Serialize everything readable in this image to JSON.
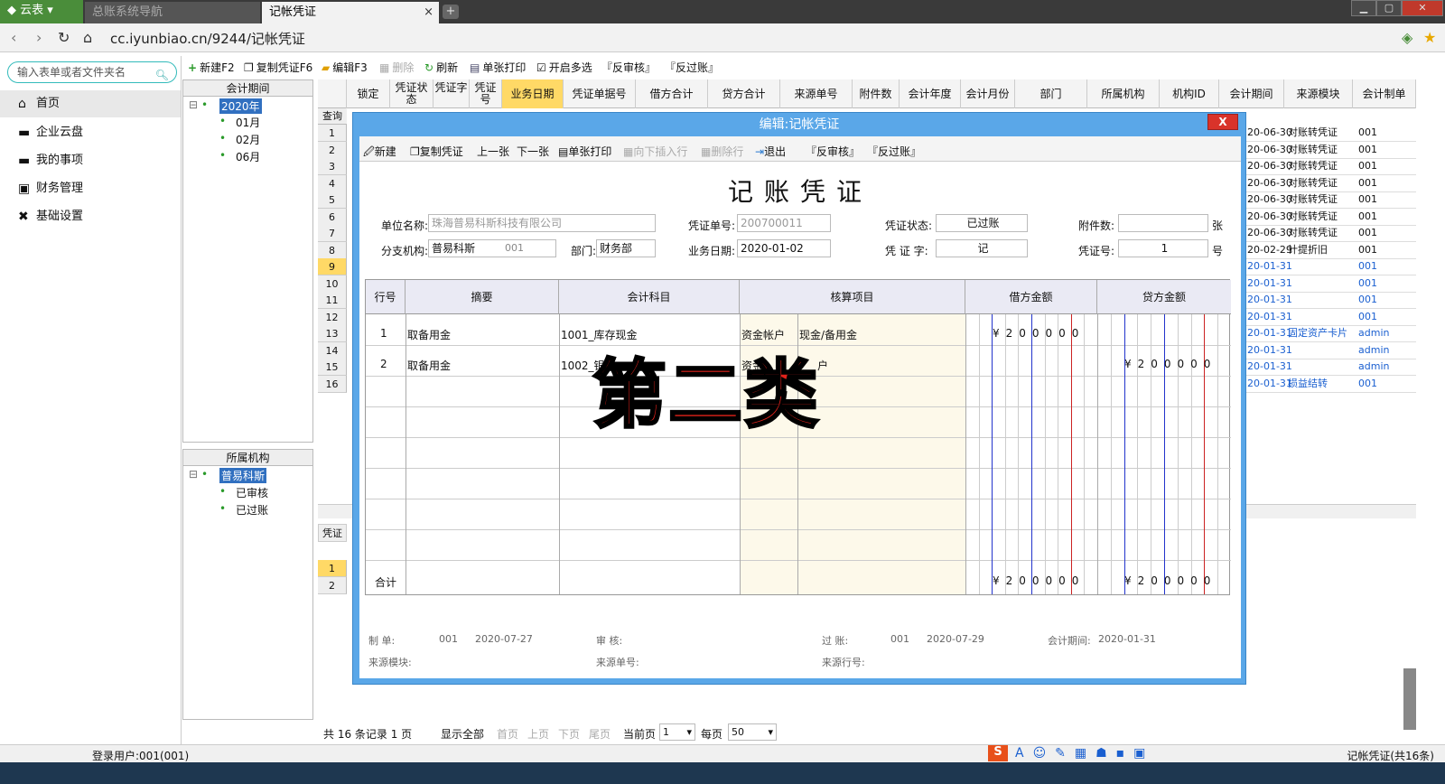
{
  "browser": {
    "app_tab": "云表",
    "tabs": [
      {
        "label": "总账系统导航"
      },
      {
        "label": "记帐凭证"
      }
    ],
    "url": "cc.iyunbiao.cn/9244/记帐凭证"
  },
  "sidebar": {
    "search_placeholder": "输入表单或者文件夹名",
    "items": [
      {
        "label": "首页"
      },
      {
        "label": "企业云盘"
      },
      {
        "label": "我的事项"
      },
      {
        "label": "财务管理"
      },
      {
        "label": "基础设置"
      }
    ]
  },
  "toolbar": {
    "new": "新建F2",
    "copy": "复制凭证F6",
    "edit": "编辑F3",
    "delete": "删除",
    "refresh": "刷新",
    "print": "单张打印",
    "multi": "开启多选",
    "unreview": "『反审核』",
    "unpost": "『反过账』"
  },
  "period_tree": {
    "header": "会计期间",
    "root": "2020年",
    "children": [
      "01月",
      "02月",
      "06月"
    ]
  },
  "org_tree": {
    "header": "所属机构",
    "root": "普易科斯",
    "children": [
      "已审核",
      "已过账"
    ]
  },
  "grid": {
    "query_label": "查询",
    "columns": [
      "锁定",
      "凭证状态",
      "凭证字",
      "凭证号",
      "业务日期",
      "凭证单据号",
      "借方合计",
      "贷方合计",
      "来源单号",
      "附件数",
      "会计年度",
      "会计月份",
      "部门",
      "所属机构",
      "机构ID",
      "会计期间",
      "来源模块",
      "会计制单"
    ],
    "rows": [
      {
        "n": "1",
        "period": "20-06-30",
        "module": "对账转凭证",
        "maker": "001"
      },
      {
        "n": "2",
        "period": "20-06-30",
        "module": "对账转凭证",
        "maker": "001"
      },
      {
        "n": "3",
        "period": "20-06-30",
        "module": "对账转凭证",
        "maker": "001"
      },
      {
        "n": "4",
        "period": "20-06-30",
        "module": "对账转凭证",
        "maker": "001"
      },
      {
        "n": "5",
        "period": "20-06-30",
        "module": "对账转凭证",
        "maker": "001"
      },
      {
        "n": "6",
        "period": "20-06-30",
        "module": "对账转凭证",
        "maker": "001"
      },
      {
        "n": "7",
        "period": "20-06-30",
        "module": "对账转凭证",
        "maker": "001"
      },
      {
        "n": "8",
        "period": "20-02-29",
        "module": "计提折旧",
        "maker": "001"
      },
      {
        "n": "9",
        "period": "20-01-31",
        "module": "",
        "maker": "001"
      },
      {
        "n": "10",
        "period": "20-01-31",
        "module": "",
        "maker": "001"
      },
      {
        "n": "11",
        "period": "20-01-31",
        "module": "",
        "maker": "001"
      },
      {
        "n": "12",
        "period": "20-01-31",
        "module": "",
        "maker": "001"
      },
      {
        "n": "13",
        "period": "20-01-31",
        "module": "固定资产卡片",
        "maker": "admin"
      },
      {
        "n": "14",
        "period": "20-01-31",
        "module": "",
        "maker": "admin"
      },
      {
        "n": "15",
        "period": "20-01-31",
        "module": "",
        "maker": "admin"
      },
      {
        "n": "16",
        "period": "20-01-31",
        "module": "损益结转",
        "maker": "001"
      }
    ],
    "detail_label": "凭证明",
    "detail_rows": [
      "1",
      "2"
    ]
  },
  "modal": {
    "title": "编辑:记帐凭证",
    "close": "X",
    "toolbar": {
      "new": "新建",
      "copy": "复制凭证",
      "prev": "上一张",
      "next": "下一张",
      "print": "单张打印",
      "insert": "向下插入行",
      "delete_row": "删除行",
      "exit": "退出",
      "unreview": "『反审核』",
      "unpost": "『反过账』"
    },
    "voucher_title": "记账凭证",
    "fields": {
      "company_label": "单位名称:",
      "company": "珠海普易科斯科技有限公司",
      "voucher_no_label": "凭证单号:",
      "voucher_no": "200700011",
      "status_label": "凭证状态:",
      "status": "已过账",
      "attach_label": "附件数:",
      "attach": "",
      "attach_unit": "张",
      "branch_label": "分支机构:",
      "branch": "普易科斯",
      "branch_code": "001",
      "dept_label": "部门:",
      "dept": "财务部",
      "date_label": "业务日期:",
      "date": "2020-01-02",
      "word_label": "凭 证 字:",
      "word": "记",
      "num_label": "凭证号:",
      "num": "1",
      "num_unit": "号"
    },
    "table": {
      "headers": [
        "行号",
        "摘要",
        "会计科目",
        "核算项目",
        "借方金额",
        "贷方金额"
      ],
      "rows": [
        {
          "line": "1",
          "summary": "取备用金",
          "account": "1001_库存现金",
          "item_type": "资金帐户",
          "item": "现金/备用金",
          "debit": "¥200000",
          "credit": ""
        },
        {
          "line": "2",
          "summary": "取备用金",
          "account": "1002_银",
          "item_type": "资金",
          "item": "户",
          "debit": "",
          "credit": "¥200000"
        }
      ],
      "total_label": "合计",
      "total_debit": "¥200000",
      "total_credit": "¥200000"
    },
    "overlay_text": "第二类",
    "footer": {
      "maker_label": "制 单:",
      "maker": "001",
      "maker_date": "2020-07-27",
      "reviewer_label": "审 核:",
      "poster_label": "过 账:",
      "poster": "001",
      "post_date": "2020-07-29",
      "period_label": "会计期间:",
      "period": "2020-01-31",
      "module_label": "来源模块:",
      "src_no_label": "来源单号:",
      "src_line_label": "来源行号:"
    }
  },
  "pager": {
    "total": "共 16 条记录 1 页",
    "show_all": "显示全部",
    "first": "首页",
    "prev": "上页",
    "next": "下页",
    "last": "尾页",
    "current_label": "当前页",
    "current": "1",
    "per_page_label": "每页",
    "per_page": "50"
  },
  "status": {
    "user": "登录用户:001(001)",
    "right": "记帐凭证(共16条)"
  },
  "colors": {
    "accent": "#5aa7e8",
    "brand": "#4a8d3a",
    "overlay": "#e0221a"
  }
}
